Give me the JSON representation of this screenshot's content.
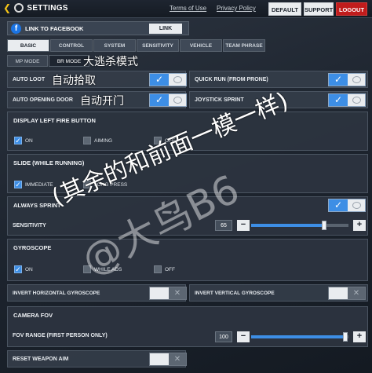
{
  "header": {
    "title": "SETTINGS",
    "terms": "Terms of Use",
    "privacy": "Privacy Policy",
    "default_btn": "DEFAULT",
    "support_btn": "SUPPORT",
    "logout_btn": "LOGOUT"
  },
  "facebook": {
    "label": "LINK TO FACEBOOK",
    "link_btn": "LINK",
    "icon_text": "f"
  },
  "tabs": [
    "BASIC",
    "CONTROL",
    "SYSTEM",
    "SENSITIVITY",
    "VEHICLE",
    "TEAM PHRASE"
  ],
  "subtabs": [
    "MP MODE",
    "BR MODE"
  ],
  "rows": {
    "auto_loot": "AUTO LOOT",
    "quick_run": "QUICK RUN (FROM PRONE)",
    "auto_door": "AUTO OPENING DOOR",
    "joystick_sprint": "JOYSTICK SPRINT",
    "always_sprint": "ALWAYS SPRINT",
    "sensitivity": "SENSITIVITY",
    "sensitivity_value": "65",
    "invert_h": "INVERT HORIZONTAL GYROSCOPE",
    "invert_v": "INVERT VERTICAL GYROSCOPE",
    "fov_range": "FOV RANGE (FIRST PERSON ONLY)",
    "fov_value": "100",
    "reset_aim": "RESET WEAPON AIM"
  },
  "levels": {
    "sensitivity": 0.75,
    "fov": 0.97
  },
  "sections": {
    "left_fire": {
      "title": "DISPLAY LEFT FIRE BUTTON",
      "options": [
        "ON",
        "AIMING",
        "OFF"
      ]
    },
    "slide": {
      "title": "SLIDE (WHILE RUNNING)",
      "options": [
        "IMMEDIATE",
        "LONG PRESS"
      ]
    },
    "gyro": {
      "title": "GYROSCOPE",
      "options": [
        "ON",
        "WHILE ADS",
        "OFF"
      ]
    },
    "camera": {
      "title": "CAMERA FOV"
    }
  },
  "annotations": {
    "br_mode": "大逃杀模式",
    "auto_loot": "自动拾取",
    "auto_door": "自动开门",
    "rest_same": "(其余的和前面一模一样)",
    "watermark": "@大鸟B6"
  },
  "icons": {
    "check": "✓",
    "cross": "✕",
    "minus": "−",
    "plus": "+"
  },
  "colors": {
    "accent": "#3d8ee5",
    "logout": "#c11c1c",
    "panel": "#343d49"
  }
}
